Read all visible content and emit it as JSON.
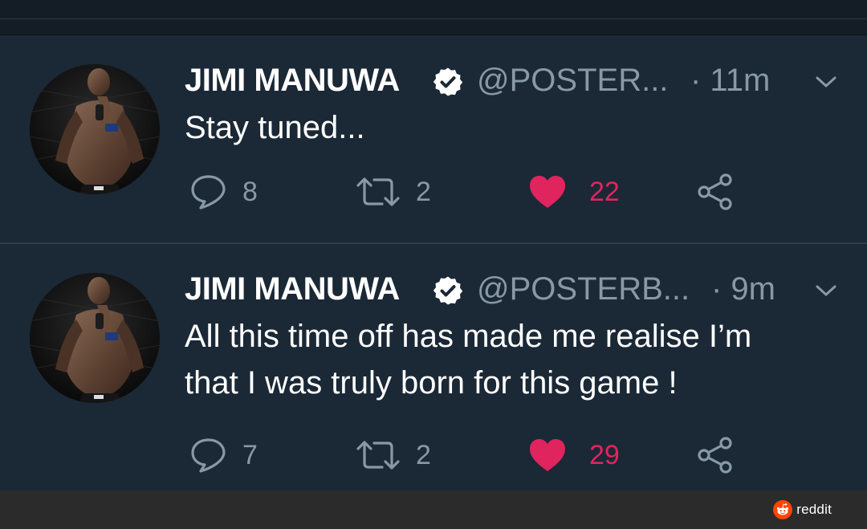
{
  "tweets": [
    {
      "name": "JIMI MANUWA",
      "handle": "@POSTER...",
      "time": "· 11m",
      "text_lines": [
        "Stay tuned..."
      ],
      "replies": "8",
      "retweets": "2",
      "likes": "22",
      "liked": true
    },
    {
      "name": "JIMI MANUWA",
      "handle": "@POSTERB...",
      "time": "· 9m",
      "text_lines": [
        "All this time off has made me realise I’m",
        "that I was truly born for this game  !"
      ],
      "replies": "7",
      "retweets": "2",
      "likes": "29",
      "liked": true
    }
  ],
  "footer": {
    "brand": "reddit"
  },
  "colors": {
    "background": "#141d26",
    "card": "#1b2836",
    "secondary_text": "#8899a6",
    "like": "#e0245e",
    "reddit_orange": "#ff4500"
  }
}
